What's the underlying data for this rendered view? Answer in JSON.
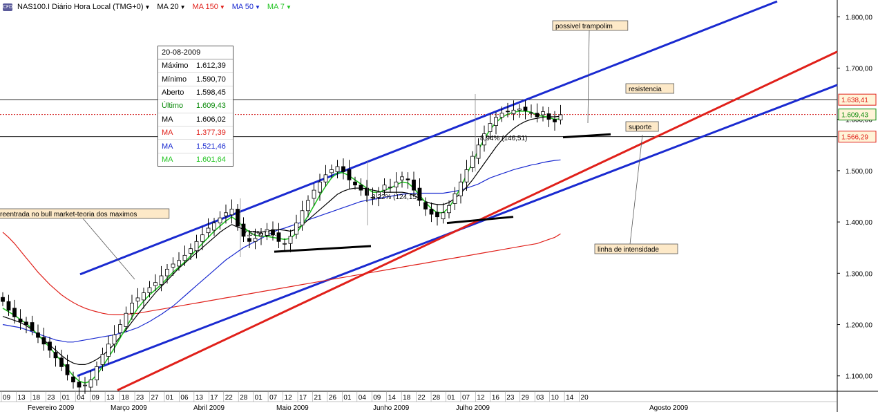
{
  "toolbar": {
    "icon": "cfd-icon",
    "icon_text": "CFD",
    "symbol": "NAS100.I Diário Hora Local (TMG+0)",
    "indicators": [
      {
        "label": "MA 20",
        "color": "#000000"
      },
      {
        "label": "MA 150",
        "color": "#e0201a"
      },
      {
        "label": "MA 50",
        "color": "#1a2ad0"
      },
      {
        "label": "MA 7",
        "color": "#22c422"
      }
    ]
  },
  "infobox": {
    "date": "20-08-2009",
    "rows": [
      {
        "label": "Máximo",
        "value": "1.612,39",
        "color": "#000000"
      },
      {
        "label": "Mínimo",
        "value": "1.590,70",
        "color": "#000000"
      },
      {
        "label": "Aberto",
        "value": "1.598,45",
        "color": "#000000"
      },
      {
        "label": "Último",
        "value": "1.609,43",
        "color": "#0a8a0a"
      },
      {
        "label": "MA",
        "value": "1.606,02",
        "color": "#000000"
      },
      {
        "label": "MA",
        "value": "1.377,39",
        "color": "#e0201a"
      },
      {
        "label": "MA",
        "value": "1.521,46",
        "color": "#1a2ad0"
      },
      {
        "label": "MA",
        "value": "1.601,64",
        "color": "#22c422"
      }
    ]
  },
  "chart_data": {
    "type": "candlestick",
    "y_axis": {
      "range": [
        1070,
        1830
      ],
      "ticks": [
        1100,
        1200,
        1300,
        1400,
        1500,
        1600,
        1700,
        1800
      ],
      "tick_labels": [
        "1.100,00",
        "1.200,00",
        "1.300,00",
        "1.400,00",
        "1.500,00",
        "1.600,00",
        "1.700,00",
        "1.800,00"
      ]
    },
    "x_axis": {
      "day_labels": [
        "09",
        "13",
        "18",
        "23",
        "01",
        "04",
        "09",
        "13",
        "18",
        "23",
        "27",
        "01",
        "06",
        "13",
        "17",
        "22",
        "28",
        "01",
        "07",
        "12",
        "17",
        "21",
        "26",
        "01",
        "04",
        "09",
        "14",
        "18",
        "22",
        "28",
        "01",
        "07",
        "12",
        "16",
        "23",
        "29",
        "03",
        "10",
        "14",
        "20"
      ],
      "month_labels": [
        {
          "label": "Fevereiro 2009",
          "at": 2
        },
        {
          "label": "Março 2009",
          "at": 8
        },
        {
          "label": "Abril 2009",
          "at": 14
        },
        {
          "label": "Maio 2009",
          "at": 20
        },
        {
          "label": "Junho 2009",
          "at": 27
        },
        {
          "label": "Julho 2009",
          "at": 33
        },
        {
          "label": "Agosto 2009",
          "at": 47
        }
      ]
    },
    "series_style": {
      "up_candle": "#ffffff",
      "down_candle": "#000000",
      "ma20": "#000000",
      "ma150": "#e0201a",
      "ma50": "#1a2ad0",
      "ma7": "#22c422"
    },
    "close": [
      1245,
      1228,
      1215,
      1205,
      1200,
      1188,
      1175,
      1162,
      1150,
      1135,
      1118,
      1102,
      1088,
      1078,
      1082,
      1092,
      1118,
      1142,
      1162,
      1180,
      1200,
      1222,
      1242,
      1252,
      1262,
      1272,
      1282,
      1295,
      1308,
      1318,
      1325,
      1335,
      1348,
      1362,
      1375,
      1388,
      1398,
      1408,
      1418,
      1425,
      1392,
      1372,
      1362,
      1368,
      1378,
      1385,
      1375,
      1362,
      1358,
      1372,
      1398,
      1422,
      1442,
      1462,
      1478,
      1492,
      1502,
      1508,
      1498,
      1482,
      1472,
      1462,
      1452,
      1448,
      1458,
      1472,
      1468,
      1478,
      1488,
      1482,
      1462,
      1442,
      1425,
      1415,
      1410,
      1418,
      1432,
      1455,
      1478,
      1502,
      1528,
      1550,
      1572,
      1592,
      1604,
      1612,
      1615,
      1618,
      1620,
      1617,
      1612,
      1605,
      1615,
      1600,
      1595,
      1609
    ],
    "ma7": [
      1232,
      1225,
      1218,
      1210,
      1202,
      1192,
      1180,
      1168,
      1155,
      1142,
      1128,
      1114,
      1100,
      1090,
      1086,
      1090,
      1102,
      1118,
      1136,
      1154,
      1174,
      1194,
      1214,
      1232,
      1246,
      1258,
      1268,
      1278,
      1290,
      1302,
      1312,
      1322,
      1334,
      1346,
      1358,
      1370,
      1382,
      1392,
      1402,
      1410,
      1402,
      1390,
      1380,
      1374,
      1372,
      1372,
      1370,
      1368,
      1366,
      1368,
      1378,
      1394,
      1412,
      1432,
      1452,
      1470,
      1486,
      1496,
      1496,
      1490,
      1482,
      1474,
      1466,
      1458,
      1458,
      1462,
      1466,
      1472,
      1478,
      1476,
      1466,
      1452,
      1438,
      1426,
      1418,
      1418,
      1428,
      1446,
      1468,
      1492,
      1516,
      1540,
      1562,
      1580,
      1594,
      1604,
      1610,
      1614,
      1616,
      1616,
      1614,
      1608,
      1606,
      1604,
      1600,
      1601
    ],
    "ma20": [
      1216,
      1212,
      1208,
      1204,
      1198,
      1190,
      1180,
      1170,
      1160,
      1150,
      1140,
      1131,
      1125,
      1122,
      1122,
      1126,
      1132,
      1140,
      1150,
      1162,
      1176,
      1190,
      1205,
      1220,
      1234,
      1248,
      1262,
      1274,
      1286,
      1298,
      1310,
      1320,
      1330,
      1340,
      1350,
      1360,
      1370,
      1380,
      1388,
      1395,
      1390,
      1386,
      1382,
      1380,
      1380,
      1382,
      1384,
      1385,
      1384,
      1382,
      1386,
      1394,
      1404,
      1414,
      1424,
      1434,
      1444,
      1454,
      1460,
      1464,
      1466,
      1466,
      1465,
      1462,
      1460,
      1458,
      1458,
      1458,
      1458,
      1456,
      1452,
      1446,
      1440,
      1436,
      1434,
      1434,
      1438,
      1446,
      1456,
      1468,
      1482,
      1498,
      1514,
      1530,
      1546,
      1560,
      1572,
      1582,
      1590,
      1596,
      1600,
      1602,
      1604,
      1605,
      1605,
      1606
    ],
    "ma50": [
      1200,
      1198,
      1196,
      1194,
      1190,
      1186,
      1182,
      1178,
      1174,
      1170,
      1168,
      1166,
      1166,
      1168,
      1170,
      1172,
      1174,
      1176,
      1178,
      1180,
      1183,
      1186,
      1190,
      1194,
      1200,
      1206,
      1213,
      1220,
      1228,
      1236,
      1246,
      1256,
      1266,
      1276,
      1286,
      1296,
      1306,
      1316,
      1326,
      1334,
      1342,
      1350,
      1356,
      1362,
      1368,
      1374,
      1380,
      1385,
      1388,
      1392,
      1396,
      1400,
      1404,
      1408,
      1412,
      1416,
      1420,
      1424,
      1428,
      1432,
      1436,
      1440,
      1442,
      1444,
      1446,
      1448,
      1450,
      1452,
      1454,
      1455,
      1456,
      1456,
      1456,
      1456,
      1456,
      1456,
      1458,
      1460,
      1462,
      1466,
      1470,
      1474,
      1480,
      1486,
      1490,
      1494,
      1498,
      1502,
      1505,
      1508,
      1511,
      1513,
      1516,
      1518,
      1520,
      1521
    ],
    "ma150": [
      1380,
      1370,
      1358,
      1344,
      1330,
      1316,
      1302,
      1290,
      1278,
      1268,
      1258,
      1250,
      1243,
      1237,
      1232,
      1228,
      1225,
      1222,
      1220,
      1219,
      1219,
      1220,
      1221,
      1222,
      1224,
      1226,
      1228,
      1230,
      1232,
      1234,
      1236,
      1238,
      1240,
      1242,
      1244,
      1246,
      1248,
      1250,
      1252,
      1254,
      1256,
      1258,
      1260,
      1262,
      1264,
      1266,
      1268,
      1270,
      1272,
      1274,
      1276,
      1278,
      1280,
      1282,
      1284,
      1286,
      1288,
      1290,
      1292,
      1294,
      1296,
      1298,
      1300,
      1302,
      1304,
      1306,
      1308,
      1310,
      1312,
      1314,
      1316,
      1318,
      1320,
      1322,
      1324,
      1326,
      1328,
      1330,
      1332,
      1334,
      1336,
      1338,
      1340,
      1342,
      1344,
      1346,
      1348,
      1350,
      1352,
      1354,
      1356,
      1358,
      1362,
      1366,
      1370,
      1377
    ],
    "price_tags": [
      {
        "value": 1638.41,
        "label": "1.638,41",
        "color": "#e0201a"
      },
      {
        "value": 1609.43,
        "label": "1.609,43",
        "color": "#0a8a0a"
      },
      {
        "value": 1566.29,
        "label": "1.566,29",
        "color": "#e0201a"
      }
    ],
    "annotations": [
      {
        "text": "possivel trampolim"
      },
      {
        "text": "resistencia"
      },
      {
        "text": "suporte"
      },
      {
        "text": "linha de intensidade"
      },
      {
        "text": "reentrada no bull market-teoria dos maximos"
      },
      {
        "text": "7,67% (1..."
      },
      {
        "text": "8,22% (124,15)"
      },
      {
        "text": "8,94% (146,51)"
      }
    ]
  }
}
